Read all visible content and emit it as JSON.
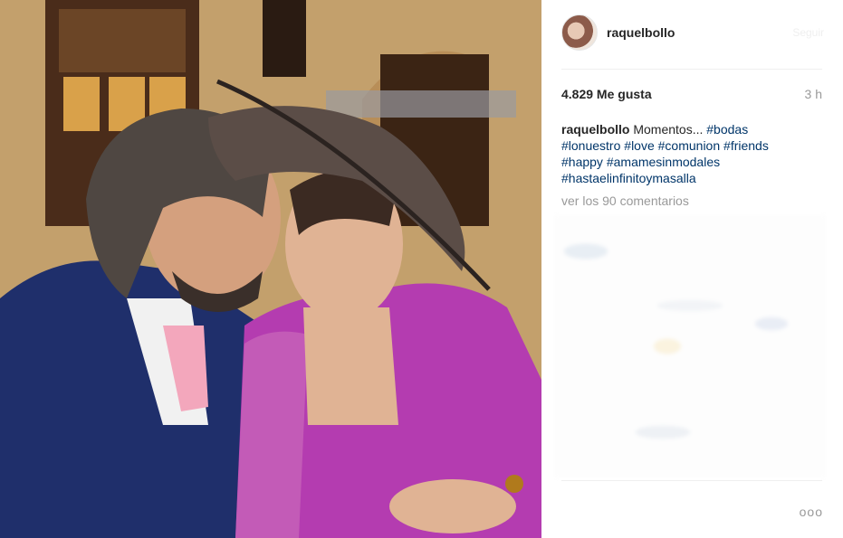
{
  "post": {
    "username": "raquelbollo",
    "follow_hint": "Seguir",
    "likes": "4.829 Me gusta",
    "time": "3 h",
    "caption_text": "Momentos...",
    "hashtags": [
      "#bodas",
      "#lonuestro",
      "#love",
      "#comunion",
      "#friends",
      "#happy",
      "#amamesinmodales",
      "#hastaelinfinitoymasalla"
    ],
    "view_comments": "ver los 90 comentarios",
    "more_options": "ooo"
  },
  "colors": {
    "hashtag": "#003569",
    "muted": "#999999",
    "text": "#262626",
    "divider": "#efefef"
  },
  "icons": {
    "more": "more-options-icon"
  }
}
